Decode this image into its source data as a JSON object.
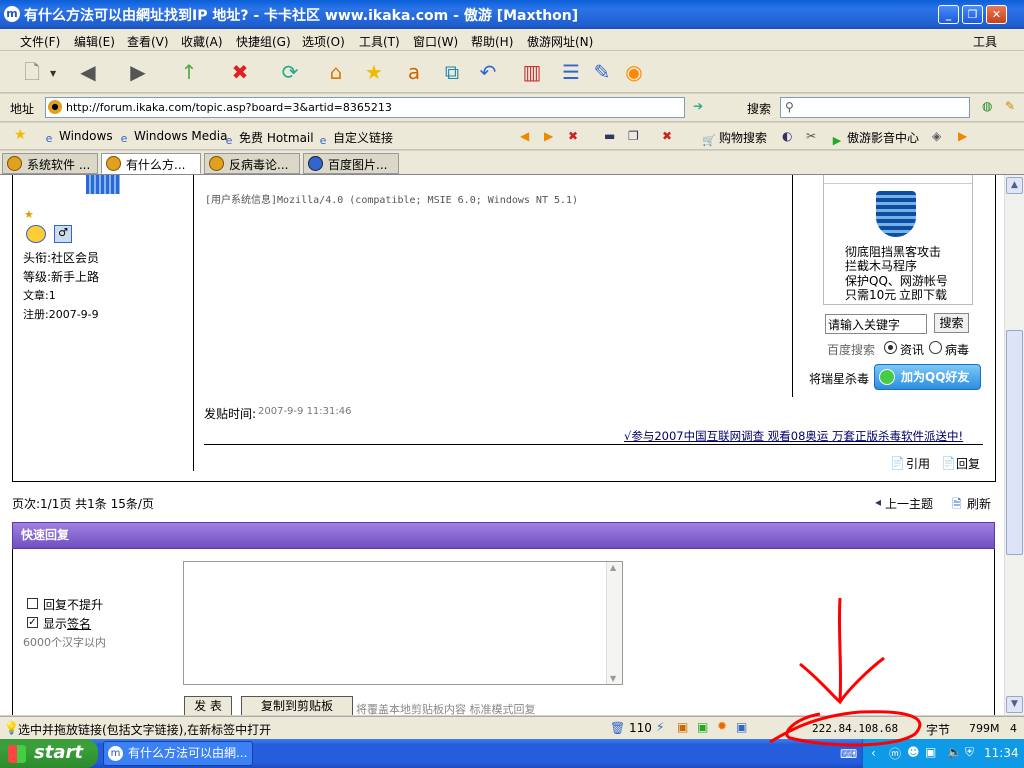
{
  "window": {
    "title": "有什么方法可以由網址找到IP 地址? - 卡卡社区 www.ikaka.com - 傲游 [Maxthon]"
  },
  "menu": [
    "文件(F)",
    "编辑(E)",
    "查看(V)",
    "收藏(A)",
    "快捷组(G)",
    "选项(O)",
    "工具(T)",
    "窗口(W)",
    "帮助(H)",
    "傲游网址(N)"
  ],
  "menu_right": "工具",
  "address": {
    "label": "地址",
    "url": "http://forum.ikaka.com/topic.asp?board=3&artid=8365213",
    "search_label": "搜索"
  },
  "favorites": [
    "Windows",
    "Windows Media",
    "免费 Hotmail",
    "自定义链接"
  ],
  "fav_right": [
    "购物搜索",
    "傲游影音中心"
  ],
  "tabs": [
    "系统软件 ...",
    "有什么方...",
    "反病毒论...",
    "百度图片..."
  ],
  "user": {
    "title": "头衔:社区会员",
    "level": "等级:新手上路",
    "posts": "文章:1",
    "registered": "注册:2007-9-9"
  },
  "post": {
    "sysinfo": "[用户系统信息]Mozilla/4.0 (compatible; MSIE 6.0; Windows NT 5.1)",
    "time_label": "发贴时间:",
    "time_value": "2007-9-9 11:31:46",
    "promo": "√参与2007中国互联网调查 观看08奥运 万套正版杀毒软件派送中!",
    "quote": "引用",
    "reply": "回复"
  },
  "ad": {
    "line1": "彻底阻挡黑客攻击",
    "line2": "拦截木马程序",
    "line3": "保护QQ、网游帐号",
    "price": "只需10元",
    "download": "立即下载"
  },
  "search": {
    "placeholder": "请输入关键字",
    "button": "搜索",
    "baidu": "百度搜索",
    "opt1": "资讯",
    "opt2": "病毒",
    "rising": "将瑞星杀毒",
    "qq": "加为QQ好友"
  },
  "pager": {
    "info": "页次:1/1页 共1条 15条/页",
    "prev": "上一主题",
    "refresh": "刷新"
  },
  "quick": {
    "title": "快速回复",
    "no_bump": "回复不提升",
    "show_sig": "显示",
    "sig": "签名",
    "limit": "6000个汉字以内",
    "submit": "发 表",
    "copy": "复制到剪贴板",
    "hint": "将覆盖本地剪贴板内容 标准模式回复"
  },
  "status": {
    "text": "选中并拖放链接(包括文字链接),在新标签中打开",
    "count": "110",
    "ip": "222.84.108.68",
    "unit": "字节",
    "mem": "799M",
    "num": "4"
  },
  "taskbar": {
    "start": "start",
    "item": "有什么方法可以由網...",
    "clock": "11:34"
  },
  "colors": {
    "title_blue": "#2c74e8",
    "purple": "#8060c8",
    "link": "#0000cc",
    "annotation_red": "#ff0000"
  }
}
